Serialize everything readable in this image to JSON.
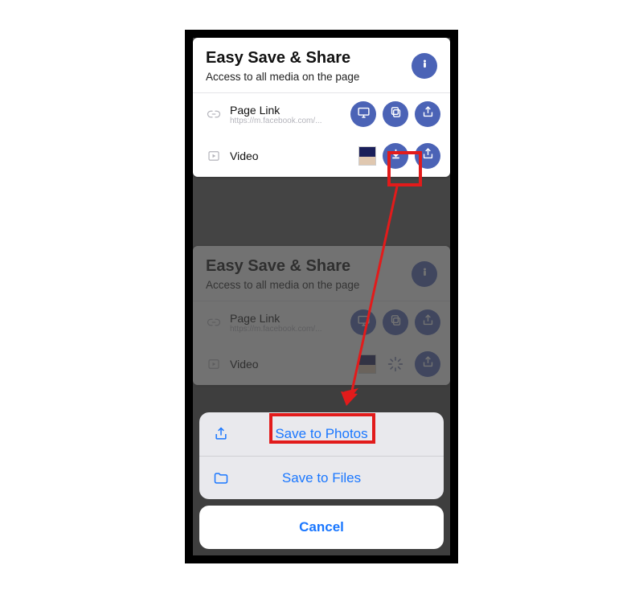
{
  "top": {
    "title": "Easy Save & Share",
    "subtitle": "Access to all media on the page",
    "info_icon": "info-icon",
    "rows": [
      {
        "icon": "link-icon",
        "name": "Page Link",
        "url": "https://m.facebook.com/...",
        "actions": [
          "display-icon",
          "copy-icon",
          "share-icon"
        ]
      },
      {
        "icon": "video-icon",
        "name": "Video",
        "thumb": true,
        "actions": [
          "download-icon",
          "share-icon"
        ]
      }
    ]
  },
  "bottom": {
    "title": "Easy Save & Share",
    "subtitle": "Access to all media on the page",
    "rows": [
      {
        "icon": "link-icon",
        "name": "Page Link",
        "url": "https://m.facebook.com/...",
        "actions": [
          "display-icon",
          "copy-icon",
          "share-icon"
        ]
      },
      {
        "icon": "video-icon",
        "name": "Video",
        "thumb": true,
        "actions": [
          "spinner-icon",
          "share-icon"
        ]
      }
    ]
  },
  "sheet": {
    "save_photos": "Save to Photos",
    "save_files": "Save to Files",
    "cancel": "Cancel"
  },
  "highlight_color": "#e21b1b",
  "accent_color": "#4b63b6",
  "ios_blue": "#1a77ff"
}
